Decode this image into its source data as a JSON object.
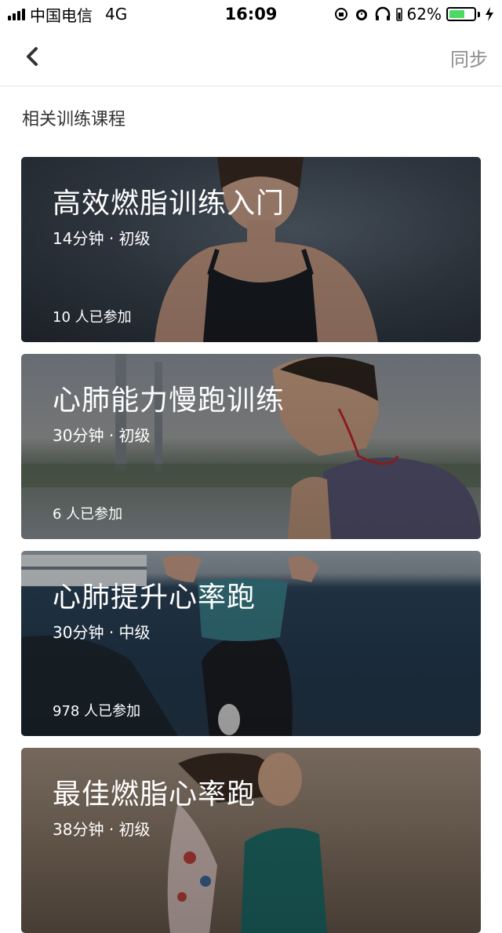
{
  "status_bar": {
    "carrier": "中国电信",
    "network": "4G",
    "time": "16:09",
    "battery": "62%",
    "battery_level": 0.62
  },
  "nav": {
    "back_icon": "chevron-left-icon",
    "sync_label": "同步"
  },
  "section_title": "相关训练课程",
  "courses": [
    {
      "title": "高效燃脂训练入门",
      "duration": "14分钟",
      "level": "初级",
      "participants": "10 人已参加"
    },
    {
      "title": "心肺能力慢跑训练",
      "duration": "30分钟",
      "level": "初级",
      "participants": "6 人已参加"
    },
    {
      "title": "心肺提升心率跑",
      "duration": "30分钟",
      "level": "中级",
      "participants": "978 人已参加"
    },
    {
      "title": "最佳燃脂心率跑",
      "duration": "38分钟",
      "level": "初级",
      "participants": ""
    }
  ],
  "colors": {
    "battery_green": "#4cd964",
    "sync_gray": "#8e8e8e",
    "divider": "#e6e6e6"
  }
}
